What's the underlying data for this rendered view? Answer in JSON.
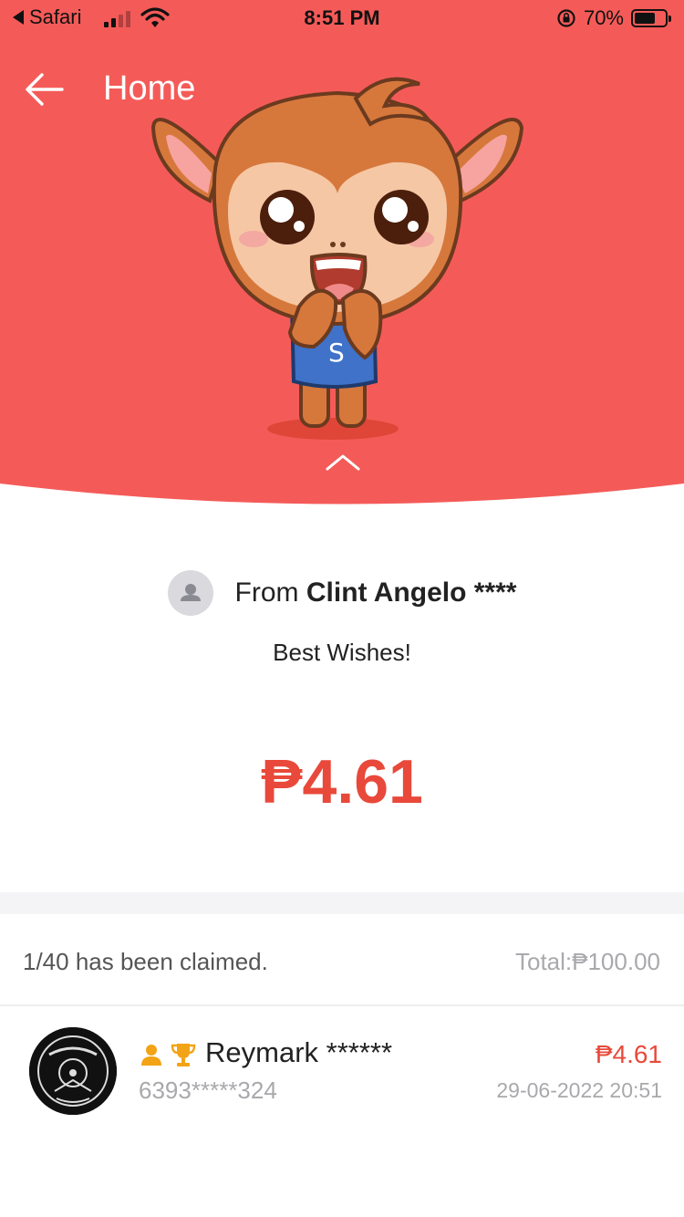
{
  "status_bar": {
    "back_app": "Safari",
    "time": "8:51 PM",
    "battery": "70%",
    "battery_level": 0.7
  },
  "nav": {
    "title": "Home",
    "back_icon": "back-arrow-icon"
  },
  "colors": {
    "header": "#f45b58",
    "amount": "#e8493a",
    "muted": "#a9a9ad"
  },
  "packet": {
    "from_label": "From",
    "sender_name": "Clint Angelo ****",
    "greeting": "Best Wishes!",
    "amount": "₱4.61"
  },
  "summary": {
    "claimed": "1/40 has been claimed.",
    "total": "Total:₱100.00"
  },
  "records": [
    {
      "name": "Reymark ******",
      "phone": "6393*****324",
      "amount": "₱4.61",
      "date": "29-06-2022 20:51",
      "badges": [
        "person-badge-icon",
        "trophy-icon"
      ]
    }
  ]
}
